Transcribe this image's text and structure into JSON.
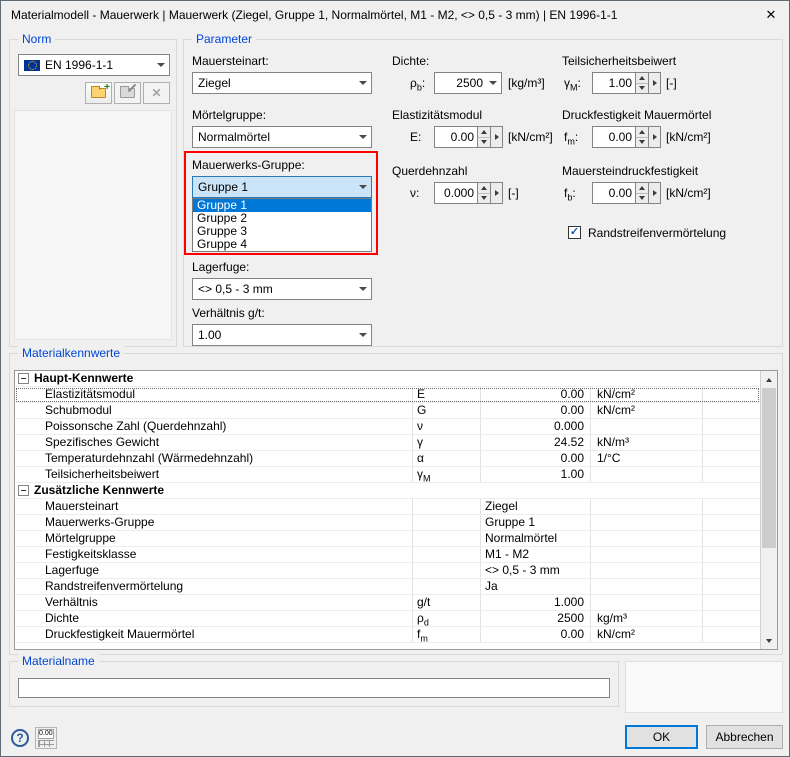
{
  "colors": {
    "accent": "#0078d7",
    "caption": "#0046d5",
    "highlight": "#ff0000"
  },
  "icons": {
    "close": "✕",
    "check": "✓",
    "help": "?",
    "plus": "+",
    "delete": "✕"
  },
  "window": {
    "title": "Materialmodell - Mauerwerk | Mauerwerk (Ziegel, Gruppe 1, Normalmörtel, M1 - M2, <> 0,5 - 3 mm) | EN 1996-1-1"
  },
  "norm": {
    "caption": "Norm",
    "selected": "EN 1996-1-1"
  },
  "parameter": {
    "caption": "Parameter",
    "mauersteinart": {
      "label": "Mauersteinart:",
      "value": "Ziegel"
    },
    "moertelgruppe": {
      "label": "Mörtelgruppe:",
      "value": "Normalmörtel"
    },
    "mauerwerksgruppe": {
      "label": "Mauerwerks-Gruppe:",
      "value": "Gruppe 1",
      "options": [
        "Gruppe 1",
        "Gruppe 2",
        "Gruppe 3",
        "Gruppe 4"
      ],
      "selected_index": 0
    },
    "lagerfuge": {
      "label": "Lagerfuge:",
      "value": "<> 0,5 - 3 mm"
    },
    "verhaeltnis": {
      "label": "Verhältnis g/t:",
      "value": "1.00"
    },
    "dichte": {
      "label": "Dichte:",
      "sym": "ρ",
      "sub": "b",
      "colon": ":",
      "value": "2500",
      "unit": "[kg/m³]"
    },
    "emodul": {
      "label": "Elastizitätsmodul",
      "sym": "E",
      "sub": "",
      "colon": ":",
      "value": "0.00",
      "unit": "[kN/cm²]"
    },
    "querdehnzahl": {
      "label": "Querdehnzahl",
      "sym": "ν",
      "sub": "",
      "colon": ":",
      "value": "0.000",
      "unit": "[-]"
    },
    "teilsicherheit": {
      "label": "Teilsicherheitsbeiwert",
      "sym": "γ",
      "sub": "M",
      "colon": ":",
      "value": "1.00",
      "unit": "[-]"
    },
    "druckfestigkeit": {
      "label": "Druckfestigkeit Mauermörtel",
      "sym": "f",
      "sub": "m",
      "colon": ":",
      "value": "0.00",
      "unit": "[kN/cm²]"
    },
    "steinfestigkeit": {
      "label": "Mauersteindruckfestigkeit",
      "sym": "f",
      "sub": "b",
      "colon": ":",
      "value": "0.00",
      "unit": "[kN/cm²]"
    },
    "randstreifen": {
      "label": "Randstreifenvermörtelung",
      "checked": true
    }
  },
  "materialkennwerte": {
    "caption": "Materialkennwerte",
    "sections": [
      {
        "header": "Haupt-Kennwerte",
        "rows": [
          {
            "name": "Elastizitätsmodul",
            "sym": "E",
            "sub": "",
            "value": "0.00",
            "unit": "kN/cm²",
            "focused": true
          },
          {
            "name": "Schubmodul",
            "sym": "G",
            "sub": "",
            "value": "0.00",
            "unit": "kN/cm²"
          },
          {
            "name": "Poissonsche Zahl (Querdehnzahl)",
            "sym": "ν",
            "sub": "",
            "value": "0.000",
            "unit": ""
          },
          {
            "name": "Spezifisches Gewicht",
            "sym": "γ",
            "sub": "",
            "value": "24.52",
            "unit": "kN/m³"
          },
          {
            "name": "Temperaturdehnzahl (Wärmedehnzahl)",
            "sym": "α",
            "sub": "",
            "value": "0.00",
            "unit": "1/°C"
          },
          {
            "name": "Teilsicherheitsbeiwert",
            "sym": "γ",
            "sub": "M",
            "value": "1.00",
            "unit": ""
          }
        ]
      },
      {
        "header": "Zusätzliche Kennwerte",
        "rows": [
          {
            "name": "Mauersteinart",
            "sym": "",
            "sub": "",
            "value": "Ziegel",
            "unit": ""
          },
          {
            "name": "Mauerwerks-Gruppe",
            "sym": "",
            "sub": "",
            "value": "Gruppe 1",
            "unit": ""
          },
          {
            "name": "Mörtelgruppe",
            "sym": "",
            "sub": "",
            "value": "Normalmörtel",
            "unit": ""
          },
          {
            "name": "Festigkeitsklasse",
            "sym": "",
            "sub": "",
            "value": "M1 - M2",
            "unit": ""
          },
          {
            "name": "Lagerfuge",
            "sym": "",
            "sub": "",
            "value": "<> 0,5 - 3 mm",
            "unit": ""
          },
          {
            "name": "Randstreifenvermörtelung",
            "sym": "",
            "sub": "",
            "value": "Ja",
            "unit": ""
          },
          {
            "name": "Verhältnis",
            "sym": "g/t",
            "sub": "",
            "value": "1.000",
            "unit": ""
          },
          {
            "name": "Dichte",
            "sym": "ρ",
            "sub": "d",
            "value": "2500",
            "unit": "kg/m³"
          },
          {
            "name": "Druckfestigkeit Mauermörtel",
            "sym": "f",
            "sub": "m",
            "value": "0.00",
            "unit": "kN/cm²"
          }
        ]
      }
    ]
  },
  "materialname": {
    "caption": "Materialname",
    "value": ""
  },
  "footer": {
    "ok": "OK",
    "cancel": "Abbrechen",
    "calc_display": "0.00"
  }
}
